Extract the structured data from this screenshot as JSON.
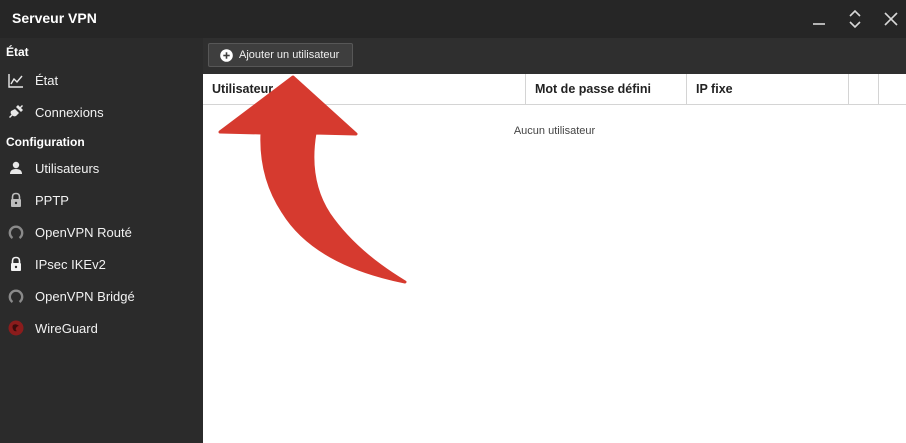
{
  "window": {
    "title": "Serveur VPN",
    "controls": [
      "minimize-icon",
      "restore-icon",
      "close-icon"
    ]
  },
  "sidebar": {
    "sections": [
      {
        "title": "État",
        "items": [
          {
            "label": "État",
            "icon": "chart-line-icon"
          },
          {
            "label": "Connexions",
            "icon": "plug-icon"
          }
        ]
      },
      {
        "title": "Configuration",
        "items": [
          {
            "label": "Utilisateurs",
            "icon": "user-icon"
          },
          {
            "label": "PPTP",
            "icon": "lock-icon"
          },
          {
            "label": "OpenVPN Routé",
            "icon": "openvpn-icon"
          },
          {
            "label": "IPsec IKEv2",
            "icon": "lock-icon"
          },
          {
            "label": "OpenVPN Bridgé",
            "icon": "openvpn-icon"
          },
          {
            "label": "WireGuard",
            "icon": "wireguard-icon"
          }
        ]
      }
    ]
  },
  "toolbar": {
    "add_user_label": "Ajouter un utilisateur"
  },
  "table": {
    "columns": [
      "Utilisateur",
      "Mot de passe défini",
      "IP fixe",
      ""
    ],
    "empty_message": "Aucun utilisateur"
  },
  "colors": {
    "titlebar": "#262626",
    "sidebar": "#2b2b2b",
    "toolbar": "#2f2f2f",
    "content": "#ffffff",
    "annotation_arrow": "#d63a2f"
  }
}
